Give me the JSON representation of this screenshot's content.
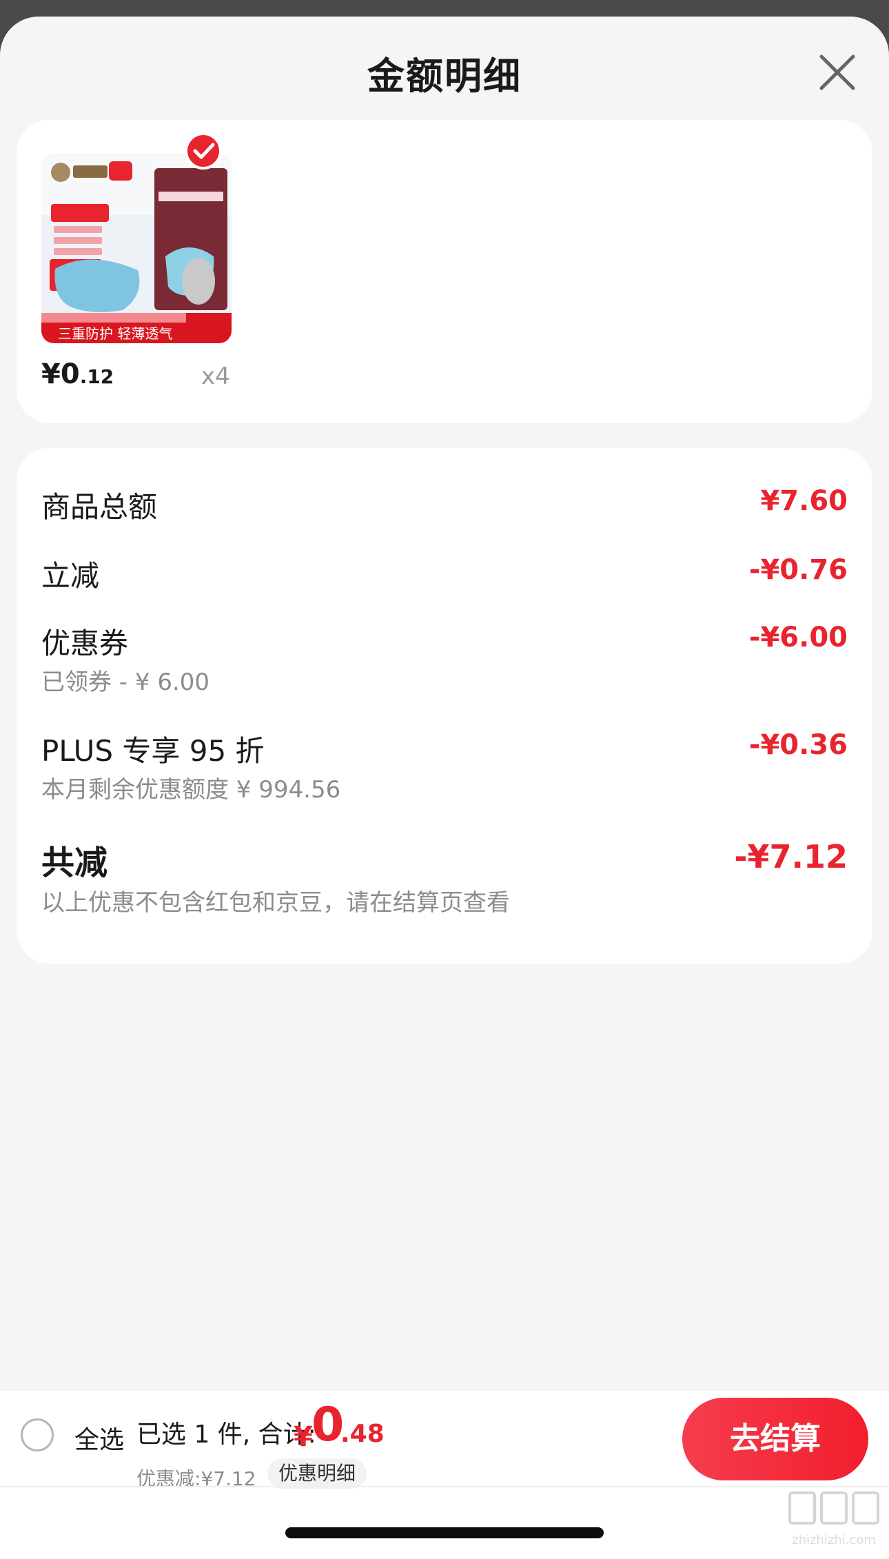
{
  "header": {
    "title": "金额明细",
    "close_icon": "close-icon"
  },
  "product": {
    "image_icon": "product-mask-image",
    "image_banner": "三重防护 轻薄透气",
    "price_yen": "¥",
    "price_int": "0",
    "price_dec": ".12",
    "quantity": "x4",
    "selected_icon": "checkmark-icon"
  },
  "details": {
    "goods_total": {
      "label": "商品总额",
      "value": "¥7.60"
    },
    "instant_discount": {
      "label": "立减",
      "value": "-¥0.76"
    },
    "coupon": {
      "label": "优惠券",
      "value": "-¥6.00",
      "sub": "已领券 - ¥ 6.00"
    },
    "plus": {
      "label": "PLUS 专享 95 折",
      "value": "-¥0.36",
      "sub": "本月剩余优惠额度  ¥ 994.56"
    },
    "total_reduction": {
      "label": "共减",
      "value": "-¥7.12",
      "sub": "以上优惠不包含红包和京豆，请在结算页查看"
    }
  },
  "bottom_bar": {
    "select_all_label": "全选",
    "summary_prefix": "已选 1 件, 合计:",
    "sum_yen": "¥",
    "sum_int": "0",
    "sum_dec": ".48",
    "discount_text": "优惠减:¥7.12",
    "discount_detail_label": "优惠明细",
    "checkout_label": "去结算"
  },
  "watermark": {
    "text": "zhizhizhi.com"
  },
  "colors": {
    "accent": "#e8242f",
    "background": "#f5f5f5",
    "card": "#ffffff",
    "text_primary": "#1a1a1a",
    "text_secondary": "#8c8c8c"
  }
}
